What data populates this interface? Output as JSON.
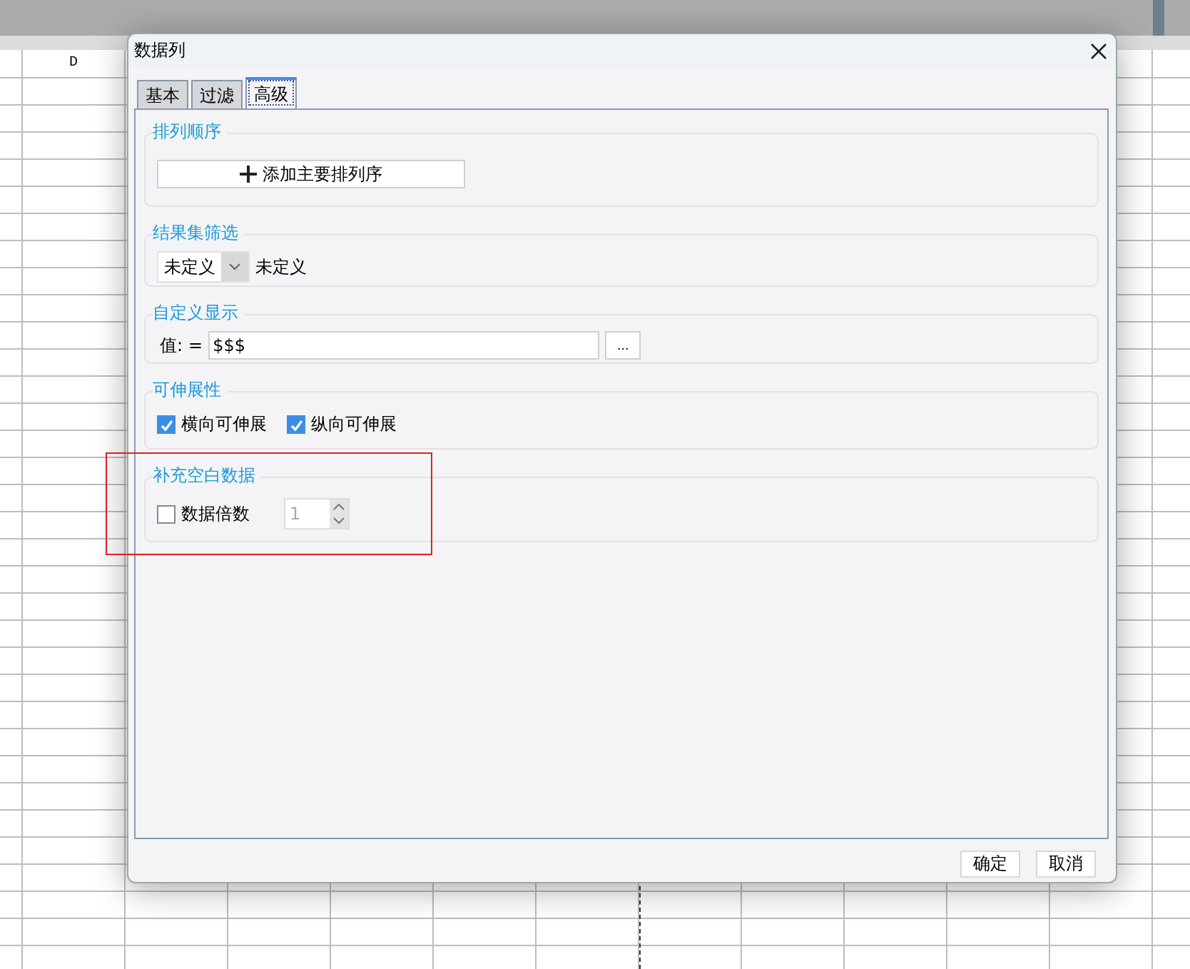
{
  "sheet": {
    "column_header": "D"
  },
  "dialog": {
    "title": "数据列",
    "tabs": [
      {
        "label": "基本",
        "selected": false
      },
      {
        "label": "过滤",
        "selected": false
      },
      {
        "label": "高级",
        "selected": true
      }
    ],
    "sections": [
      {
        "kind": "sort",
        "title": "排列顺序",
        "button": "添加主要排列序"
      },
      {
        "kind": "filter",
        "title": "结果集筛选",
        "select": "未定义",
        "value": "未定义"
      },
      {
        "kind": "display",
        "title": "自定义显示",
        "label": "值:",
        "equals": "=",
        "value": "$$$",
        "button": "..."
      },
      {
        "kind": "checks",
        "title": "可伸展性",
        "options": [
          {
            "label": "横向可伸展",
            "checked": true
          },
          {
            "label": "纵向可伸展",
            "checked": true
          }
        ]
      },
      {
        "kind": "fill",
        "title": "补充空白数据",
        "highlighted": true,
        "option": {
          "label": "数据倍数",
          "checked": false
        },
        "spinner": {
          "value": "1",
          "disabled": true
        }
      }
    ],
    "buttons": [
      "确定",
      "取消"
    ]
  }
}
